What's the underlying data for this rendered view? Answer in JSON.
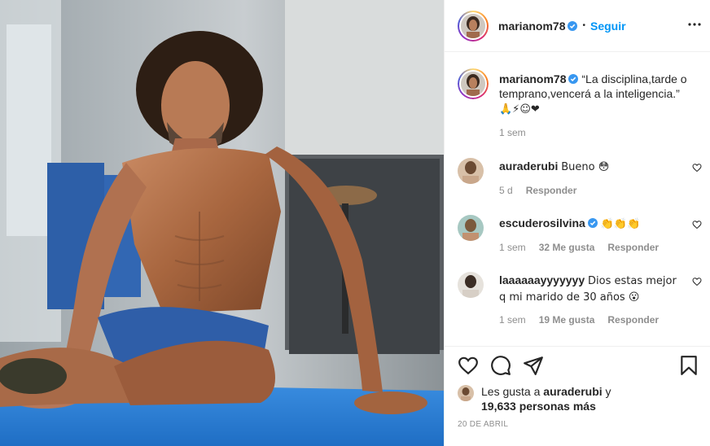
{
  "post": {
    "username": "marianom78",
    "follow_label": "Seguir",
    "separator": "•",
    "caption_text": "“La disciplina,tarde o temprano,vencerá a la inteligencia.”",
    "caption_emojis": "🙏⚡☺❤",
    "caption_time": "1 sem"
  },
  "comments": [
    {
      "username": "auraderubi",
      "text": "Bueno 😳",
      "time": "5 d",
      "likes": "",
      "reply": "Responder"
    },
    {
      "username": "escuderosilvina",
      "verified": true,
      "text": "👏👏👏",
      "time": "1 sem",
      "likes": "32 Me gusta",
      "reply": "Responder"
    },
    {
      "username": "laaaaaayyyyyyy",
      "text": "Dios estas mejor q mi marido de 30 años 😮",
      "time": "1 sem",
      "likes": "19 Me gusta",
      "reply": "Responder"
    }
  ],
  "actions": {
    "likes_prefix": "Les gusta a",
    "likes_user": "auraderubi",
    "likes_suffix": "y",
    "likes_count": "19,633 personas más",
    "date": "20 DE ABRIL"
  },
  "colors": {
    "accent": "#0095f6",
    "text": "#262626",
    "muted": "#8e8e8e",
    "verified": "#3897f0",
    "heart": "#ed4956",
    "mat": "#2e7fd6"
  },
  "icons": [
    "verified-icon",
    "more-options-icon",
    "heart-icon",
    "comment-icon",
    "share-icon",
    "bookmark-icon"
  ]
}
